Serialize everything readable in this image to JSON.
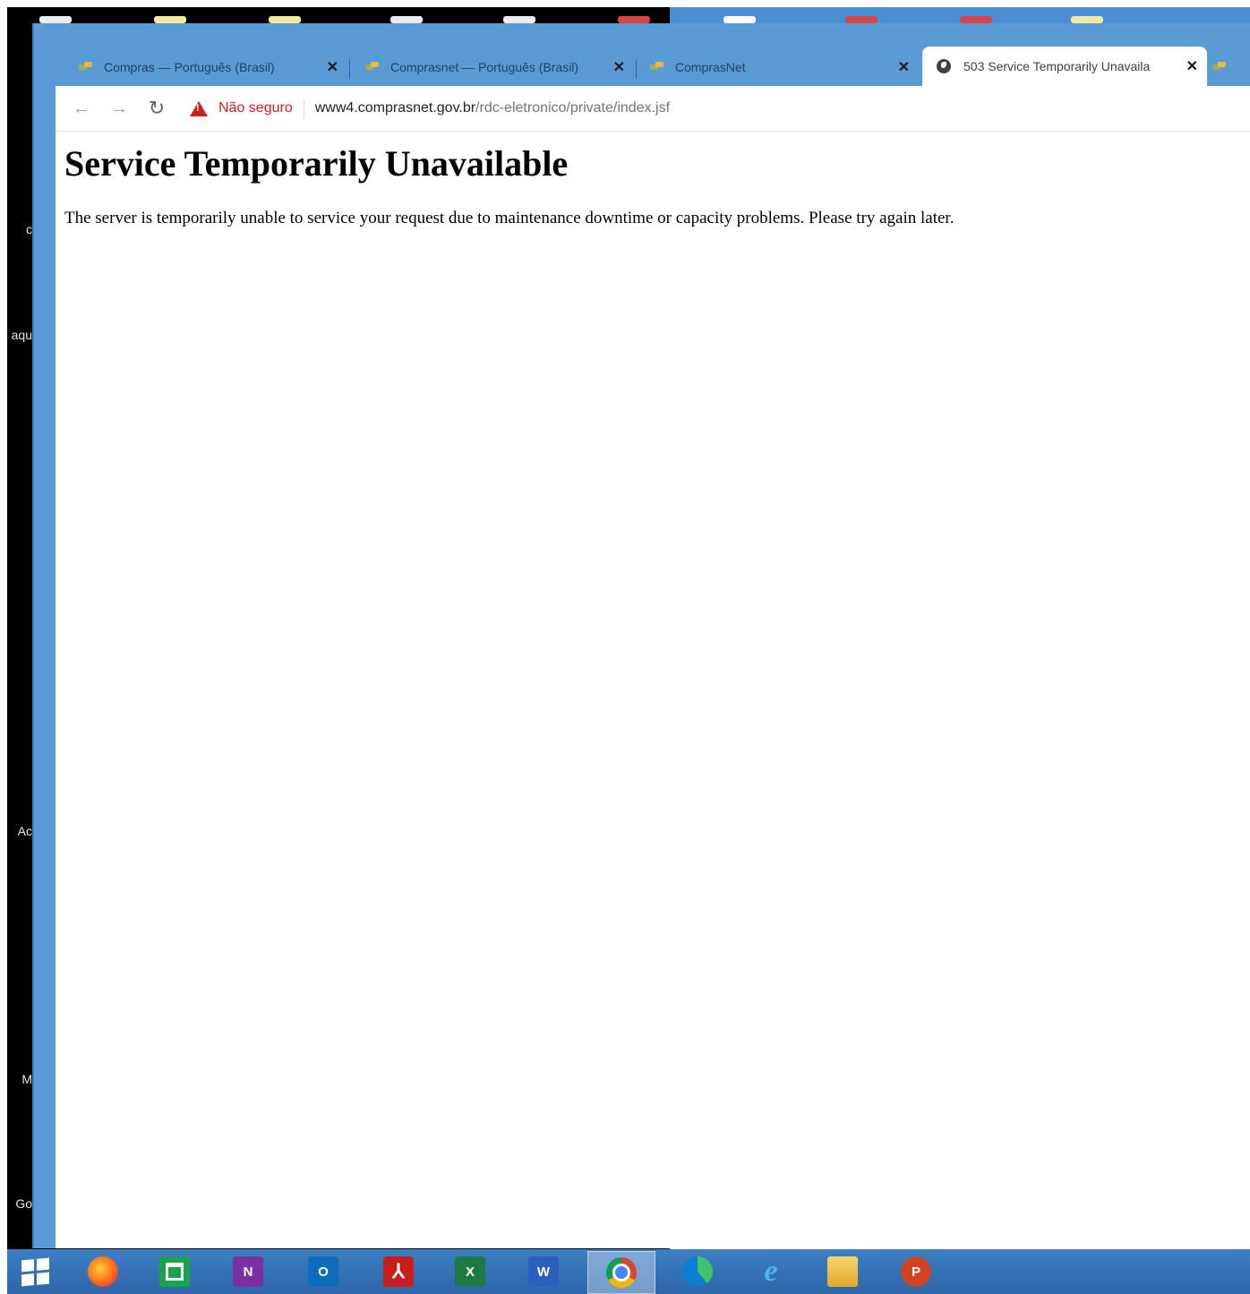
{
  "desktop": {
    "side_texts": [
      "c",
      "aqu",
      "Ac",
      "M",
      "Go"
    ]
  },
  "tabs": [
    {
      "title": "Compras — Português (Brasil)",
      "active": false
    },
    {
      "title": "Comprasnet — Português (Brasil)",
      "active": false
    },
    {
      "title": "ComprasNet",
      "active": false
    },
    {
      "title": "503 Service Temporarily Unavaila",
      "active": true
    },
    {
      "title": "",
      "active": false
    }
  ],
  "toolbar": {
    "security_label": "Não seguro",
    "url_host": "www4.comprasnet.gov.br",
    "url_path": "/rdc-eletronico/private/index.jsf"
  },
  "page": {
    "title": "Service Temporarily Unavailable",
    "message": "The server is temporarily unable to service your request due to maintenance downtime or capacity problems. Please try again later."
  },
  "taskbar": {
    "apps": [
      "start",
      "firefox",
      "store",
      "onenote",
      "outlook",
      "acrobat",
      "excel",
      "word",
      "chrome",
      "edge",
      "internet-explorer",
      "file-explorer",
      "powerpoint"
    ],
    "letters": {
      "onenote": "N",
      "outlook": "O",
      "excel": "X",
      "word": "W",
      "powerpoint": "P"
    },
    "colors": {
      "accent": "#5b9bd5",
      "insecure": "#c5221f"
    }
  }
}
